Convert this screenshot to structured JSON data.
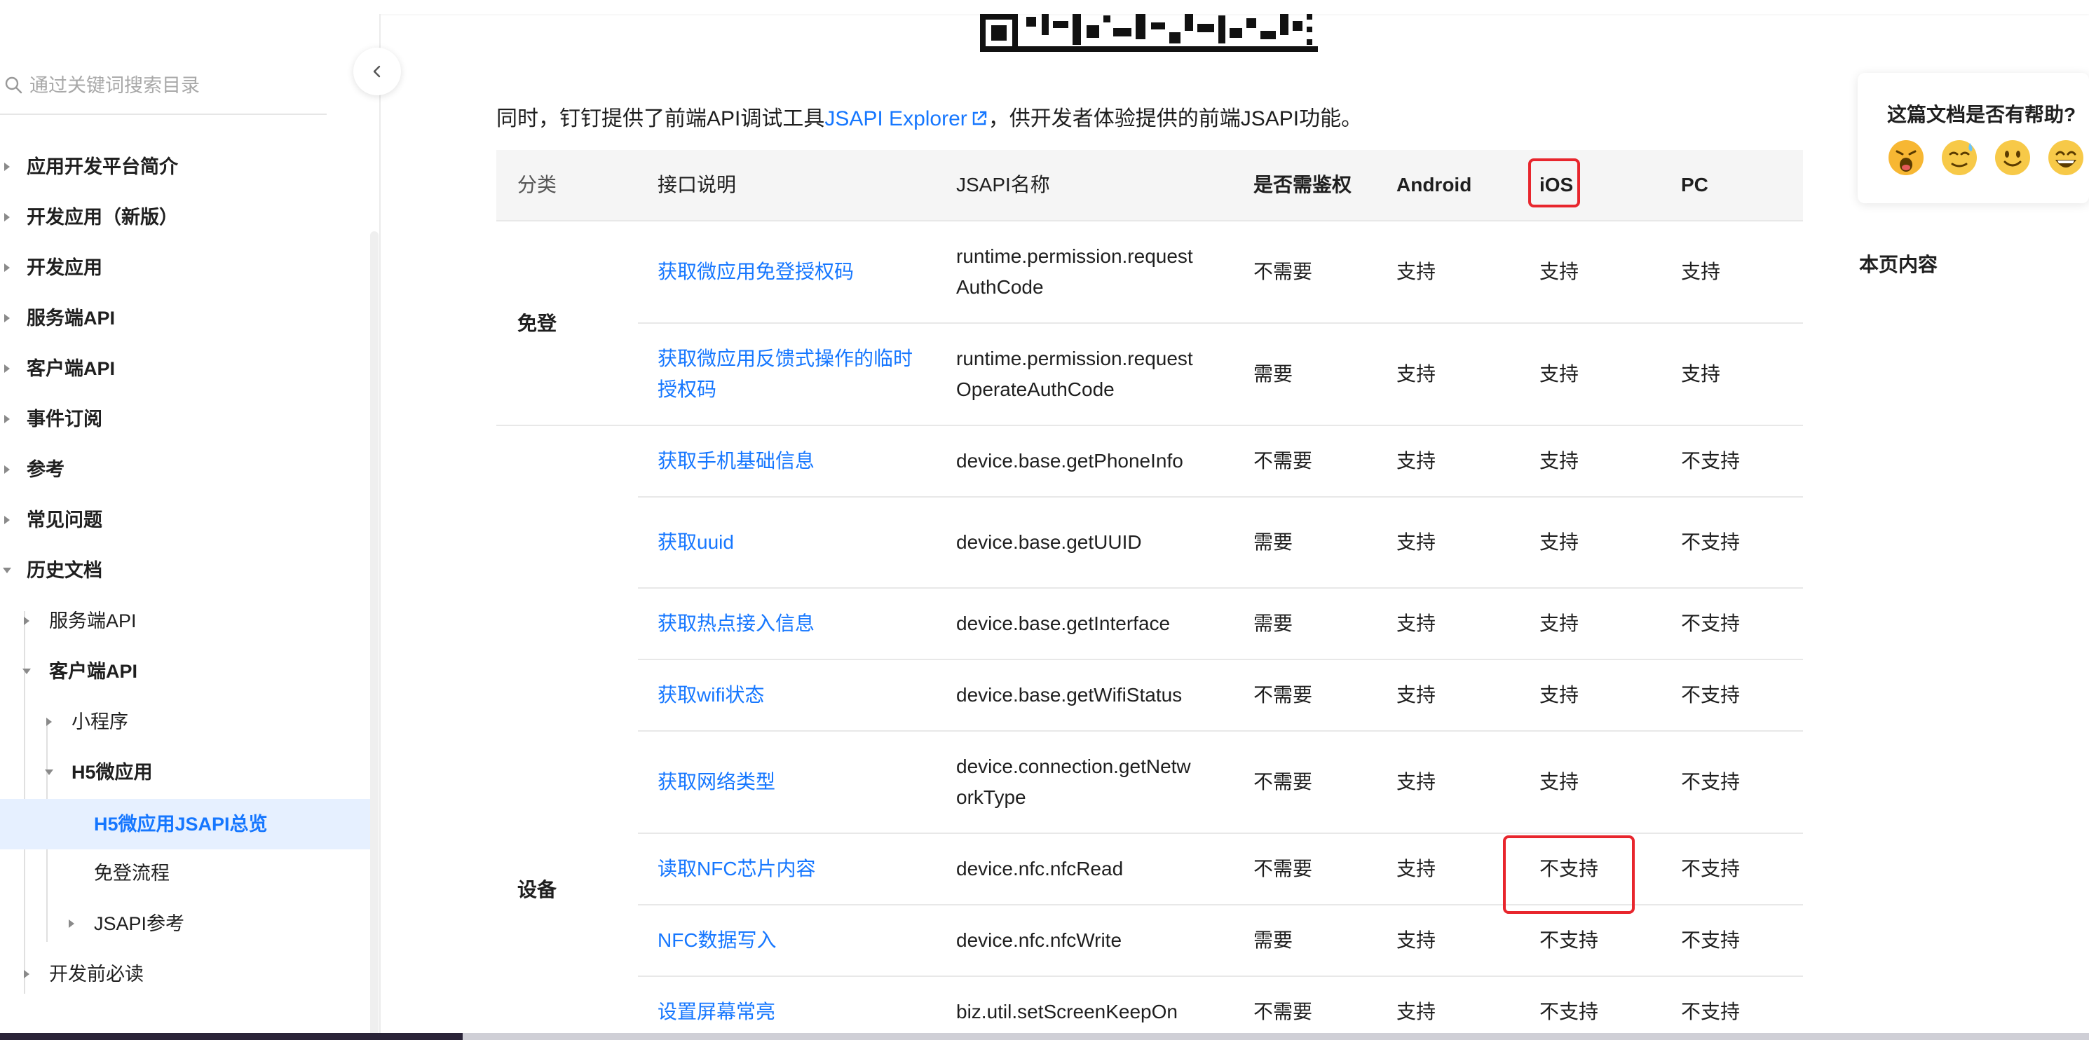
{
  "sidebar": {
    "search_placeholder": "通过关键词搜索目录",
    "items": [
      {
        "label": "应用开发平台简介"
      },
      {
        "label": "开发应用（新版）"
      },
      {
        "label": "开发应用"
      },
      {
        "label": "服务端API"
      },
      {
        "label": "客户端API"
      },
      {
        "label": "事件订阅"
      },
      {
        "label": "参考"
      },
      {
        "label": "常见问题"
      },
      {
        "label": "历史文档"
      },
      {
        "label": "服务端API"
      },
      {
        "label": "客户端API"
      },
      {
        "label": "小程序"
      },
      {
        "label": "H5微应用"
      },
      {
        "label": "H5微应用JSAPI总览"
      },
      {
        "label": "免登流程"
      },
      {
        "label": "JSAPI参考"
      },
      {
        "label": "开发前必读"
      }
    ]
  },
  "main": {
    "intro_before": "同时，钉钉提供了前端API调试工具",
    "intro_link": "JSAPI Explorer",
    "intro_after": "，供开发者体验提供的前端JSAPI功能。",
    "table": {
      "headers": [
        "分类",
        "接口说明",
        "JSAPI名称",
        "是否需鉴权",
        "Android",
        "iOS",
        "PC"
      ],
      "groups": [
        "免登",
        "设备"
      ],
      "rows": [
        {
          "desc": [
            "获取微应用免登授权码"
          ],
          "api": [
            "runtime.permission.request",
            "AuthCode"
          ],
          "auth": "不需要",
          "android": "支持",
          "ios": "支持",
          "pc": "支持"
        },
        {
          "desc": [
            "获取微应用反馈式操作的临时",
            "授权码"
          ],
          "api": [
            "runtime.permission.request",
            "OperateAuthCode"
          ],
          "auth": "需要",
          "android": "支持",
          "ios": "支持",
          "pc": "支持"
        },
        {
          "desc": [
            "获取手机基础信息"
          ],
          "api": [
            "device.base.getPhoneInfo"
          ],
          "auth": "不需要",
          "android": "支持",
          "ios": "支持",
          "pc": "不支持"
        },
        {
          "desc": [
            "获取uuid"
          ],
          "api": [
            "device.base.getUUID"
          ],
          "auth": "需要",
          "android": "支持",
          "ios": "支持",
          "pc": "不支持"
        },
        {
          "desc": [
            "获取热点接入信息"
          ],
          "api": [
            "device.base.getInterface"
          ],
          "auth": "需要",
          "android": "支持",
          "ios": "支持",
          "pc": "不支持"
        },
        {
          "desc": [
            "获取wifi状态"
          ],
          "api": [
            "device.base.getWifiStatus"
          ],
          "auth": "不需要",
          "android": "支持",
          "ios": "支持",
          "pc": "不支持"
        },
        {
          "desc": [
            "获取网络类型"
          ],
          "api": [
            "device.connection.getNetw",
            "orkType"
          ],
          "auth": "不需要",
          "android": "支持",
          "ios": "支持",
          "pc": "不支持"
        },
        {
          "desc": [
            "读取NFC芯片内容"
          ],
          "api": [
            "device.nfc.nfcRead"
          ],
          "auth": "不需要",
          "android": "支持",
          "ios": "不支持",
          "pc": "不支持"
        },
        {
          "desc": [
            "NFC数据写入"
          ],
          "api": [
            "device.nfc.nfcWrite"
          ],
          "auth": "需要",
          "android": "支持",
          "ios": "不支持",
          "pc": "不支持"
        },
        {
          "desc": [
            "设置屏幕常亮"
          ],
          "api": [
            "biz.util.setScreenKeepOn"
          ],
          "auth": "不需要",
          "android": "支持",
          "ios": "不支持",
          "pc": "不支持"
        }
      ]
    }
  },
  "right_panel": {
    "feedback_title": "这篇文档是否有帮助?",
    "emojis": [
      "angry-face-icon",
      "sweat-face-icon",
      "smile-face-icon",
      "grin-face-icon"
    ],
    "toc_title": "本页内容"
  },
  "colors": {
    "accent": "#1677ff",
    "highlight": "#e8262d",
    "active_bg": "#e6f0ff"
  }
}
